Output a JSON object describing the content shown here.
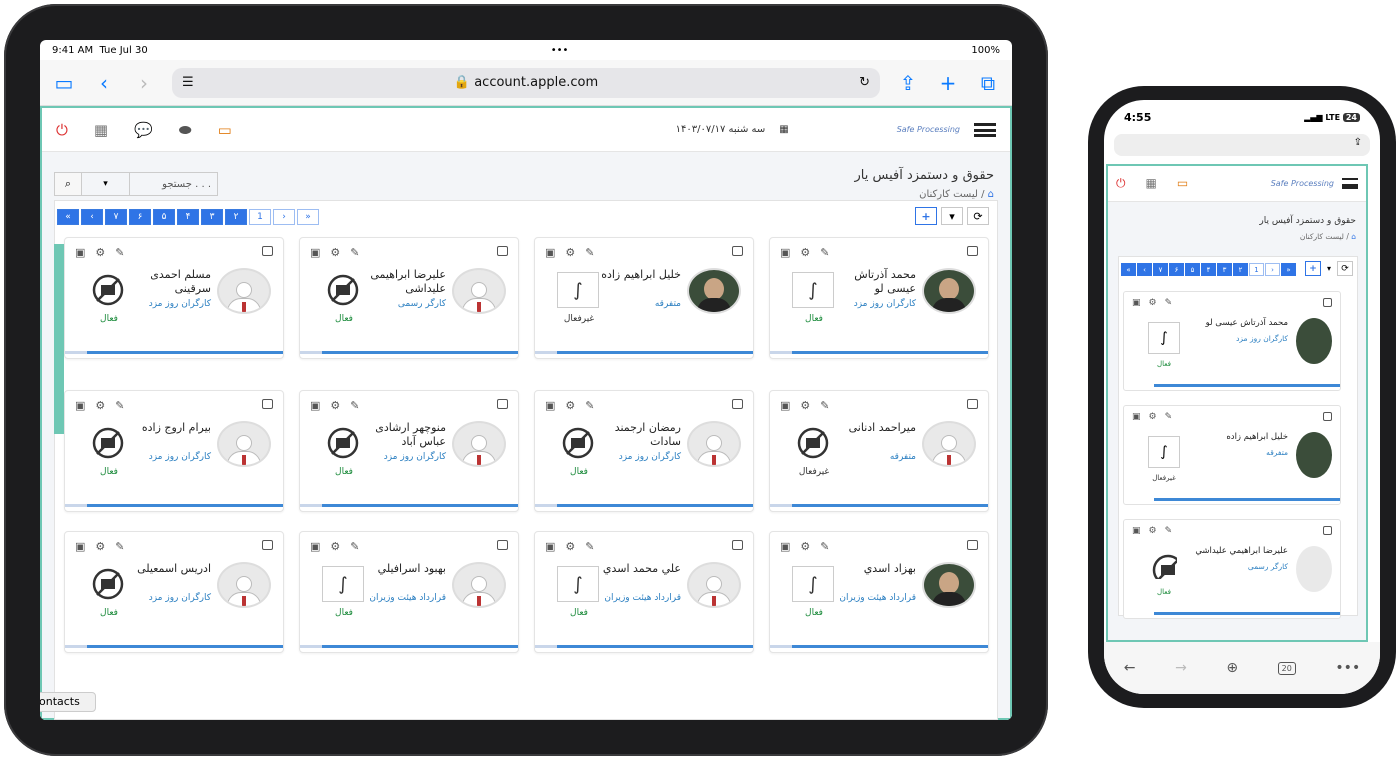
{
  "tablet": {
    "status": {
      "time": "9:41 AM",
      "date": "Tue Jul 30",
      "battery": "100%"
    },
    "url": "account.apple.com",
    "app": {
      "date_text": "سه شنبه ۱۴۰۳/۰۷/۱۷",
      "logo_text": "Safe Processing",
      "page_title": "حقوق و دستمزد آفیس یار",
      "breadcrumb": "لیست کارکنان",
      "breadcrumb_sep": "/",
      "search_placeholder": "جستجو . . .",
      "pager": [
        "«",
        "‹",
        "۷",
        "۶",
        "۵",
        "۴",
        "۳",
        "۲",
        "1",
        "›",
        "»"
      ],
      "cards": [
        {
          "name": "محمد آذرتاش عیسی لو",
          "type": "کارگران روز مزد",
          "status": "فعال",
          "avatar": "photo",
          "sig": "signature"
        },
        {
          "name": "خلیل ابراهیم زاده",
          "type": "متفرقه",
          "status": "غیرفعال",
          "avatar": "photo",
          "sig": "signature"
        },
        {
          "name": "علیرضا ابراهیمی علیداشی",
          "type": "کارگر رسمی",
          "status": "فعال",
          "avatar": "default",
          "sig": "none"
        },
        {
          "name": "مسلم احمدی سرقینی",
          "type": "کارگران روز مزد",
          "status": "فعال",
          "avatar": "default",
          "sig": "none"
        },
        {
          "name": "میراحمد ادنانی",
          "type": "متفرقه",
          "status": "غیرفعال",
          "avatar": "default",
          "sig": "none"
        },
        {
          "name": "رمضان ارجمند سادات",
          "type": "کارگران روز مزد",
          "status": "فعال",
          "avatar": "default",
          "sig": "none"
        },
        {
          "name": "منوچهر ارشادی عباس آباد",
          "type": "کارگران روز مزد",
          "status": "فعال",
          "avatar": "default",
          "sig": "none"
        },
        {
          "name": "بیرام اروج زاده",
          "type": "کارگران روز مزد",
          "status": "فعال",
          "avatar": "default",
          "sig": "none"
        },
        {
          "name": "بهزاد اسدي",
          "type": "قرارداد هیئت وزیران",
          "status": "فعال",
          "avatar": "photo",
          "sig": "signature"
        },
        {
          "name": "علي محمد اسدي",
          "type": "قرارداد هیئت وزیران",
          "status": "فعال",
          "avatar": "default",
          "sig": "signature"
        },
        {
          "name": "بهبود اسرافیلي",
          "type": "قرارداد هیئت وزیران",
          "status": "فعال",
          "avatar": "default",
          "sig": "signature"
        },
        {
          "name": "ادریس اسمعیلی",
          "type": "کارگران روز مزد",
          "status": "فعال",
          "avatar": "default",
          "sig": "none"
        }
      ],
      "contacts_tab": "ontacts"
    }
  },
  "phone": {
    "status": {
      "time": "4:55",
      "network": "LTE",
      "battery": "24"
    },
    "app": {
      "page_title": "حقوق و دستمزد آفیس یار",
      "breadcrumb": "لیست کارکنان",
      "pager": [
        "«",
        "‹",
        "۷",
        "۶",
        "۵",
        "۴",
        "۳",
        "۲",
        "1",
        "›",
        "»"
      ],
      "cards": [
        {
          "name": "محمد آذرتاش عیسی لو",
          "type": "کارگران روز مزد",
          "status": "فعال"
        },
        {
          "name": "خلیل ابراهیم زاده",
          "type": "متفرقه",
          "status": "غیرفعال"
        },
        {
          "name": "علیرضا ابراهیمي علیداشي",
          "type": "کارگر رسمی",
          "status": "فعال"
        }
      ],
      "tabs_count": "20"
    }
  },
  "colors": {
    "accent": "#2f74e6",
    "frame": "#6ec7b4",
    "active": "#1a8a3a",
    "link": "#2b7fc1"
  }
}
